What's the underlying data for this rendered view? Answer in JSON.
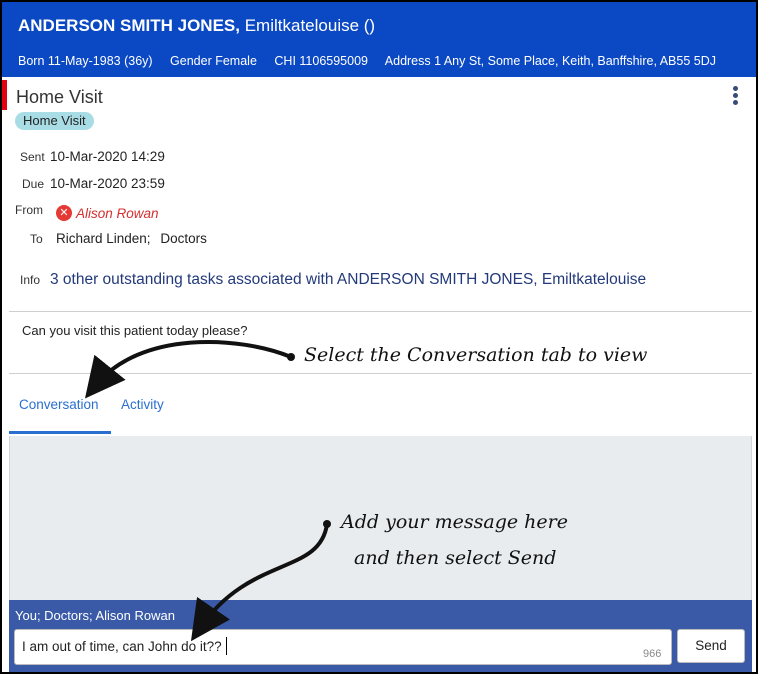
{
  "patient": {
    "name_bold": "ANDERSON SMITH JONES,",
    "name_rest": "Emiltkatelouise ()",
    "born": "Born 11-May-1983 (36y)",
    "gender": "Gender Female",
    "chi": "CHI 1106595009",
    "address": "Address 1 Any St, Some Place, Keith, Banffshire, AB55 5DJ"
  },
  "task": {
    "title": "Home Visit",
    "tag": "Home Visit",
    "sent_label": "Sent",
    "sent_value": "10-Mar-2020 14:29",
    "due_label": "Due",
    "due_value": "10-Mar-2020 23:59",
    "from_label": "From",
    "from_value": "Alison Rowan",
    "to_label": "To",
    "to_value": "Richard Linden;",
    "to_value2": "Doctors",
    "info_label": "Info",
    "info_link": "3 other outstanding tasks associated with ANDERSON SMITH JONES, Emiltkatelouise",
    "message": "Can you visit this patient today please?"
  },
  "tabs": [
    {
      "label": "Conversation",
      "active": true
    },
    {
      "label": "Activity",
      "active": false
    }
  ],
  "composer": {
    "recipients": "You; Doctors; Alison Rowan",
    "input_value": "I am out of time, can John do it??",
    "char_count": "966",
    "send_label": "Send"
  },
  "annotations": {
    "tab_hint": "Select the Conversation tab to view",
    "send_hint_line1": "Add your message here",
    "send_hint_line2": "and then select Send"
  },
  "icons": {
    "menu": "kebab-menu-icon",
    "from_status": "error-x-icon"
  },
  "colors": {
    "banner": "#0b49c4",
    "tab_active": "#2a6fcf",
    "composer": "#3a5aa8",
    "alert_red": "#e3000f",
    "tag_bg": "#a9dde6"
  }
}
